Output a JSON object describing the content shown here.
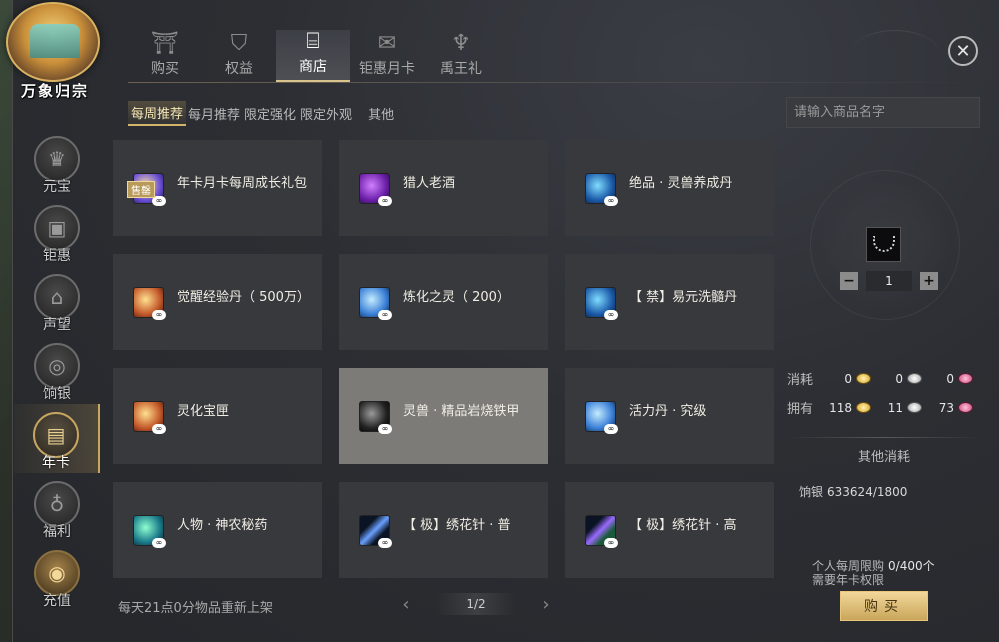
{
  "logo": {
    "text": "万象归宗"
  },
  "sidebar": {
    "items": [
      {
        "label": "元宝",
        "icon": "crown-icon",
        "glyph": "♛"
      },
      {
        "label": "钜惠",
        "icon": "gift-box-icon",
        "glyph": "▣"
      },
      {
        "label": "声望",
        "icon": "pavilion-icon",
        "glyph": "⌂"
      },
      {
        "label": "饷银",
        "icon": "coin-icon",
        "glyph": "◎"
      },
      {
        "label": "年卡",
        "icon": "card-icon",
        "glyph": "▤"
      },
      {
        "label": "福利",
        "icon": "money-bag-icon",
        "glyph": "♁"
      },
      {
        "label": "充值",
        "icon": "coin-stack-icon",
        "glyph": "◉"
      }
    ]
  },
  "top_tabs": [
    {
      "label": "购买",
      "icon": "gate-icon",
      "glyph": "⛩"
    },
    {
      "label": "权益",
      "icon": "shield-icon",
      "glyph": "⛉"
    },
    {
      "label": "商店",
      "icon": "shop-basket-icon",
      "glyph": "⌸"
    },
    {
      "label": "钜惠月卡",
      "icon": "scroll-icon",
      "glyph": "✉"
    },
    {
      "label": "禹王礼",
      "icon": "trident-icon",
      "glyph": "♆"
    }
  ],
  "sub_tabs": [
    {
      "label": "每周推荐"
    },
    {
      "label": "每月推荐"
    },
    {
      "label": "限定强化"
    },
    {
      "label": "限定外观"
    },
    {
      "label": "其他"
    }
  ],
  "search": {
    "placeholder": "请输入商品名字",
    "value": ""
  },
  "products": [
    {
      "name": "年卡月卡每周成长礼包",
      "icon": "gift-card-icon",
      "color": "ic-card",
      "tag": "售罄"
    },
    {
      "name": "猎人老酒",
      "icon": "wine-jar-icon",
      "color": "ic-purple"
    },
    {
      "name": "绝品 · 灵兽养成丹",
      "icon": "blue-orb-icon",
      "color": "ic-blue"
    },
    {
      "name": "觉醒经验丹（ 500万）",
      "icon": "exp-pill-icon",
      "color": "ic-gold",
      "badge": "500W"
    },
    {
      "name": "炼化之灵（ 200）",
      "icon": "spirit-crystal-icon",
      "color": "ic-sky",
      "badge": "200"
    },
    {
      "name": "【 禁】易元洗髓丹",
      "icon": "swirl-orb-icon",
      "color": "ic-blue"
    },
    {
      "name": "灵化宝匣",
      "icon": "treasure-box-icon",
      "color": "ic-gold"
    },
    {
      "name": "灵兽 · 精品岩烧铁甲",
      "icon": "chain-armor-icon",
      "color": "ic-dark"
    },
    {
      "name": "活力丹 · 究级",
      "icon": "vitality-orb-icon",
      "color": "ic-sky"
    },
    {
      "name": "人物 · 神农秘药",
      "icon": "herb-potion-icon",
      "color": "ic-green"
    },
    {
      "name": "【 极】绣花针 · 普",
      "icon": "needle-icon",
      "color": "ic-blade"
    },
    {
      "name": "【 极】绣花针 · 高",
      "icon": "needle-icon",
      "color": "ic-blade2"
    }
  ],
  "infinity_mark": "∞",
  "footer": {
    "refresh_text": "每天21点0分物品重新上架",
    "page": "1/2",
    "prev": "‹",
    "next": "›"
  },
  "detail": {
    "quantity": "1",
    "minus": "−",
    "plus": "+",
    "consume_label": "消耗",
    "consume": [
      "0",
      "0",
      "0"
    ],
    "own_label": "拥有",
    "own": [
      "118",
      "11",
      "73"
    ],
    "other_title": "其他消耗",
    "other_item_label": "饷银",
    "other_item_value": "633624/1800",
    "limit_label": "个人每周限购",
    "limit_count": "0/400个",
    "limit_note": "需要年卡权限",
    "buy_label": "购买"
  },
  "close_glyph": "✕"
}
